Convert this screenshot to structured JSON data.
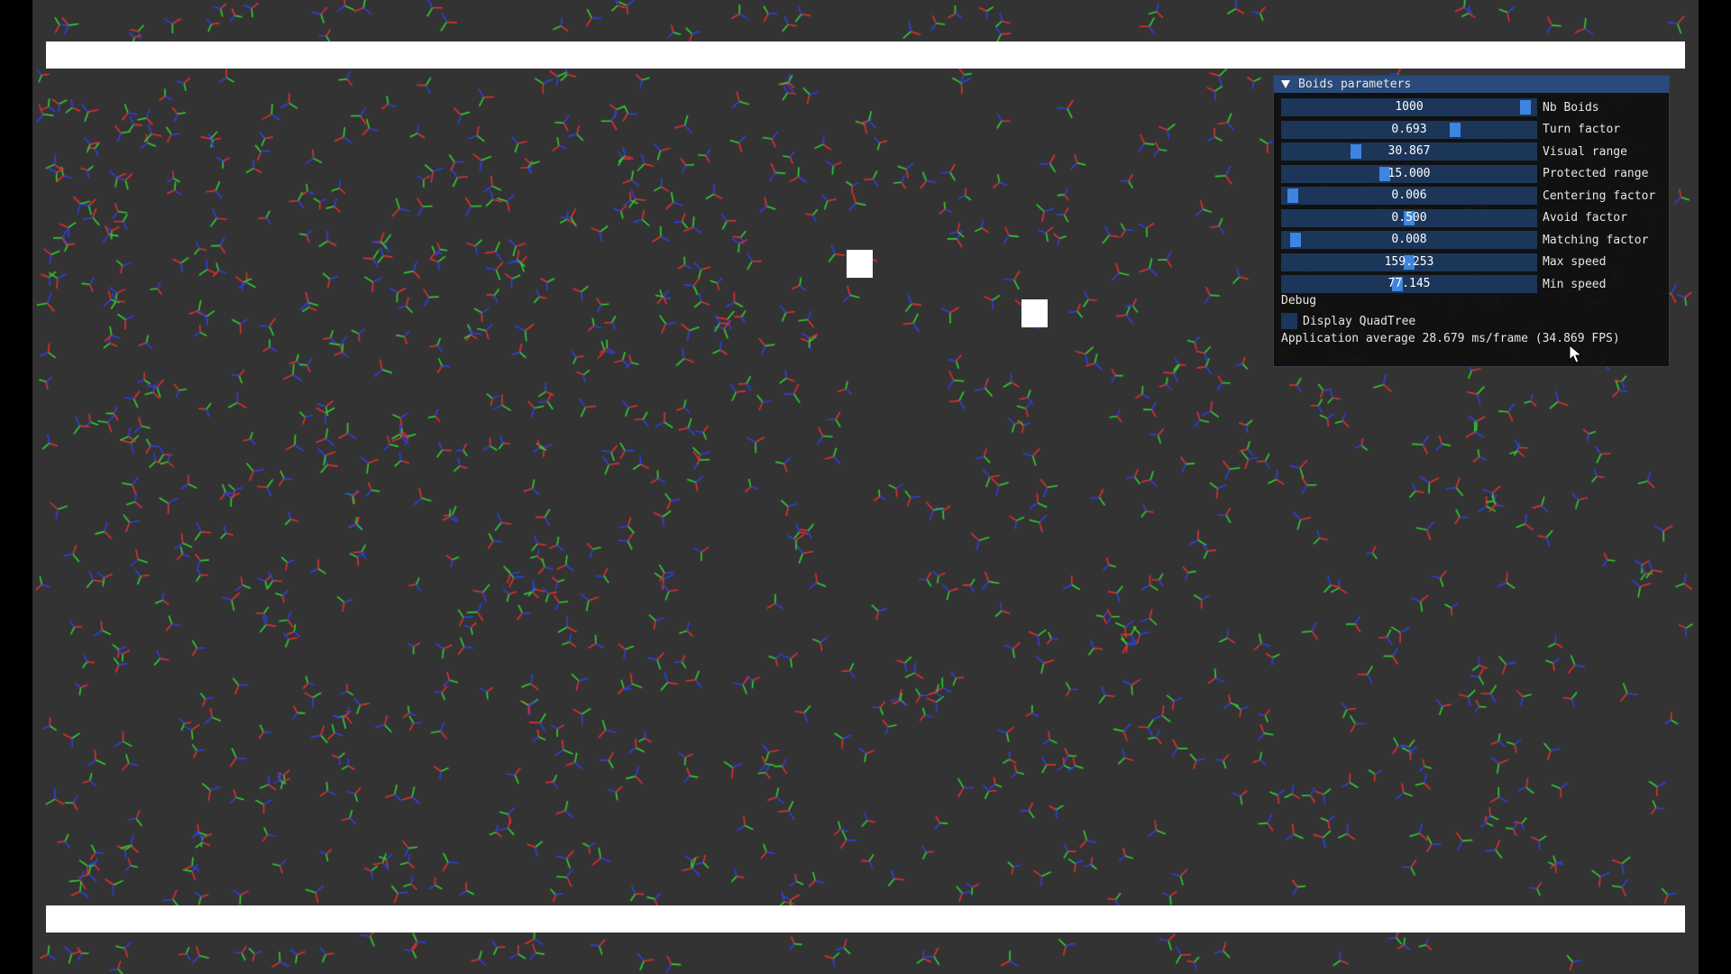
{
  "panel": {
    "title": "Boids parameters",
    "sliders": [
      {
        "value": "1000",
        "label": "Nb Boids",
        "fraction": 0.98
      },
      {
        "value": "0.693",
        "label": "Turn factor",
        "fraction": 0.69
      },
      {
        "value": "30.867",
        "label": "Visual range",
        "fraction": 0.28
      },
      {
        "value": "15.000",
        "label": "Protected range",
        "fraction": 0.4
      },
      {
        "value": "0.006",
        "label": "Centering factor",
        "fraction": 0.02
      },
      {
        "value": "0.500",
        "label": "Avoid factor",
        "fraction": 0.5
      },
      {
        "value": "0.008",
        "label": "Matching factor",
        "fraction": 0.03
      },
      {
        "value": "159.253",
        "label": "Max speed",
        "fraction": 0.5
      },
      {
        "value": "77.145",
        "label": "Min speed",
        "fraction": 0.45
      }
    ],
    "debug_header": "Debug",
    "quadtree_label": "Display QuadTree",
    "quadtree_checked": false,
    "fps_text": "Application average 28.679 ms/frame (34.869 FPS)"
  },
  "scene": {
    "background_color": "#333333",
    "wall_color": "#ffffff",
    "boid_colors": [
      "#e03030",
      "#30d030",
      "#3040e0"
    ]
  },
  "icons": {
    "collapse": "triangle-down-icon",
    "cursor": "mouse-pointer-icon"
  }
}
